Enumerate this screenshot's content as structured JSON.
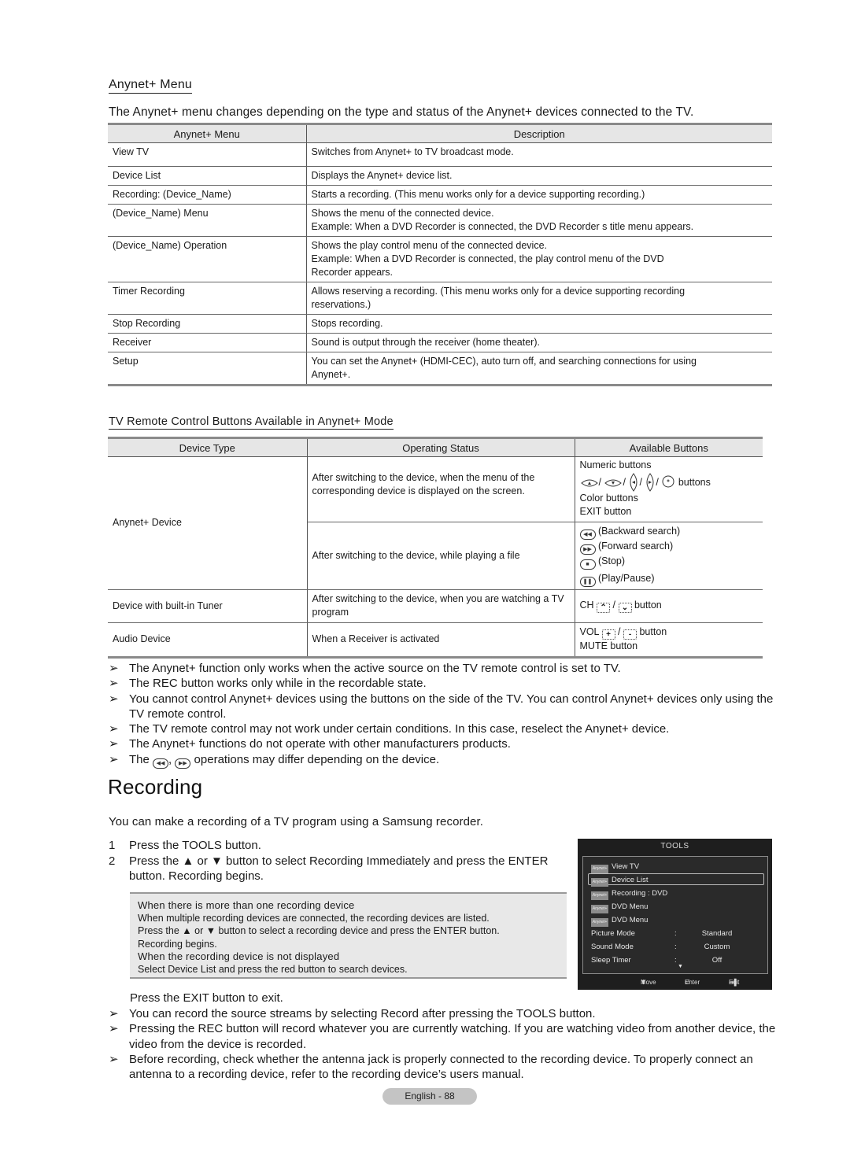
{
  "anynet_menu": {
    "heading": "Anynet+ Menu",
    "intro": "The Anynet+ menu changes depending on the type and status of the Anynet+ devices connected to the TV.",
    "table": {
      "headers": [
        "Anynet+ Menu",
        "Description"
      ],
      "rows": [
        {
          "menu": "View TV",
          "desc": "Switches from Anynet+ to TV broadcast mode."
        },
        {
          "menu": "Device List",
          "desc": "Displays the Anynet+ device list."
        },
        {
          "menu": "Recording: (Device_Name)",
          "desc": "Starts a recording. (This menu works only for a device supporting recording.)"
        },
        {
          "menu": "(Device_Name) Menu",
          "desc": "Shows the menu of the connected device.",
          "desc2": "Example: When a DVD Recorder is connected, the DVD Recorder s title menu appears."
        },
        {
          "menu": "(Device_Name) Operation",
          "desc": "Shows the play control menu of the connected device.",
          "desc2": "Example: When a DVD Recorder is connected, the play control menu of the DVD",
          "desc3": "Recorder appears."
        },
        {
          "menu": "Timer Recording",
          "desc": "Allows reserving a recording. (This menu works only for a device supporting recording",
          "desc2": "reservations.)"
        },
        {
          "menu": "Stop Recording",
          "desc": "Stops recording."
        },
        {
          "menu": "Receiver",
          "desc": "Sound is output through the receiver (home theater)."
        },
        {
          "menu": "Setup",
          "desc": "You can set the Anynet+ (HDMI-CEC), auto turn off, and searching connections for using",
          "desc2": "Anynet+."
        }
      ]
    }
  },
  "remote_buttons": {
    "heading": "TV  Remote Control Buttons Available in Anynet+ Mode",
    "headers": [
      "Device Type",
      "Operating Status",
      "Available Buttons"
    ],
    "anynet_device": {
      "type": "Anynet+ Device",
      "status1": "After switching to the device, when the menu of the corresponding device is displayed on the screen.",
      "buttons1": {
        "numeric": "Numeric buttons",
        "nav_suffix": "buttons",
        "sep": "/",
        "color": "Color buttons",
        "exit": "EXIT button"
      },
      "status2": "After switching to the device, while playing a file",
      "buttons2": {
        "backward": "(Backward search)",
        "forward": "(Forward search)",
        "stop": "(Stop)",
        "play": "(Play/Pause)"
      }
    },
    "tuner_device": {
      "type": "Device with built-in Tuner",
      "status": "After switching to the device, when you are watching a TV program",
      "prefix": "CH",
      "sep": "/",
      "suffix": "button"
    },
    "audio_device": {
      "type": "Audio Device",
      "status": "When a Receiver is activated",
      "prefix": "VOL",
      "sep": "/",
      "suffix": "button",
      "mute": "MUTE button"
    }
  },
  "notes": [
    "The Anynet+ function only works when the active source on the TV remote control is set to TV.",
    "The REC button works only while in the recordable state.",
    "You cannot control Anynet+ devices using the buttons on the side of the TV. You can control Anynet+ devices only using the TV remote control.",
    "The TV remote control may not work under certain conditions. In this case, reselect the Anynet+ device.",
    "The Anynet+ functions do not operate with other manufacturers  products."
  ],
  "note_last": {
    "pre": "The",
    "mid": ",",
    "post": "operations may differ depending on the device."
  },
  "note_arrow": "➢",
  "recording": {
    "title": "Recording",
    "lead": "You can make a recording of a TV program using a Samsung recorder.",
    "steps": [
      {
        "num": "1",
        "text": "Press the TOOLS button."
      },
      {
        "num": "2",
        "text": "Press the ▲ or ▼ button to select Recording Immediately and press the ENTER button. Recording begins."
      }
    ],
    "notebox": {
      "h1": "When there is more than one recording device",
      "l1": "When multiple recording devices are connected, the recording devices are listed.",
      "l2": "Press the ▲ or ▼ button to select a recording device and press the ENTER button.",
      "l3": "Recording begins.",
      "h2": "When the recording device is not displayed",
      "l4": "Select Device List and press the red button to search devices."
    },
    "exit_line": "Press the EXIT button to exit.",
    "notes": [
      "You can record the source streams by selecting Record after pressing the TOOLS button.",
      "Pressing the REC button will record whatever you are currently watching. If you are watching video from another device, the video from the device is recorded.",
      "Before recording, check whether the antenna jack is properly connected to the recording device. To properly connect an antenna to a recording device, refer to the recording device’s users manual."
    ]
  },
  "tools_menu": {
    "title": "TOOLS",
    "logo_text": "Anynet+",
    "items": [
      "View TV",
      "Device List",
      "Recording : DVD",
      "DVD Menu",
      "DVD Menu"
    ],
    "selected": "Device List",
    "settings": [
      {
        "key": "Picture Mode",
        "sep": ":",
        "value": "Standard"
      },
      {
        "key": "Sound Mode",
        "sep": ":",
        "value": "Custom"
      },
      {
        "key": "Sleep Timer",
        "sep": ":",
        "value": "Off"
      }
    ],
    "footer": {
      "move": "Move",
      "enter": "Enter",
      "exit": "Exit"
    }
  },
  "page_number": "English - 88"
}
